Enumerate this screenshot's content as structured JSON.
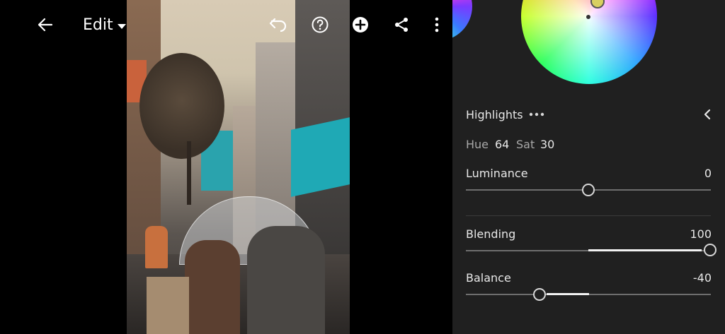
{
  "toolbar": {
    "edit_label": "Edit",
    "icons": [
      "back-arrow-icon",
      "caret-down-icon",
      "undo-icon",
      "help-icon",
      "add-icon",
      "share-icon",
      "more-vertical-icon"
    ]
  },
  "panel": {
    "section_title": "Highlights",
    "hue_label": "Hue",
    "hue_value": "64",
    "sat_label": "Sat",
    "sat_value": "30",
    "sliders": [
      {
        "label": "Luminance",
        "value": "0",
        "level": 0.5
      },
      {
        "label": "Blending",
        "value": "100",
        "level": 1.0
      },
      {
        "label": "Balance",
        "value": "-40",
        "level": 0.3
      }
    ]
  },
  "colors": {
    "panel_bg": "#202020",
    "slider_fill": "#f2f2f2",
    "slider_track": "#6e6e6e"
  }
}
